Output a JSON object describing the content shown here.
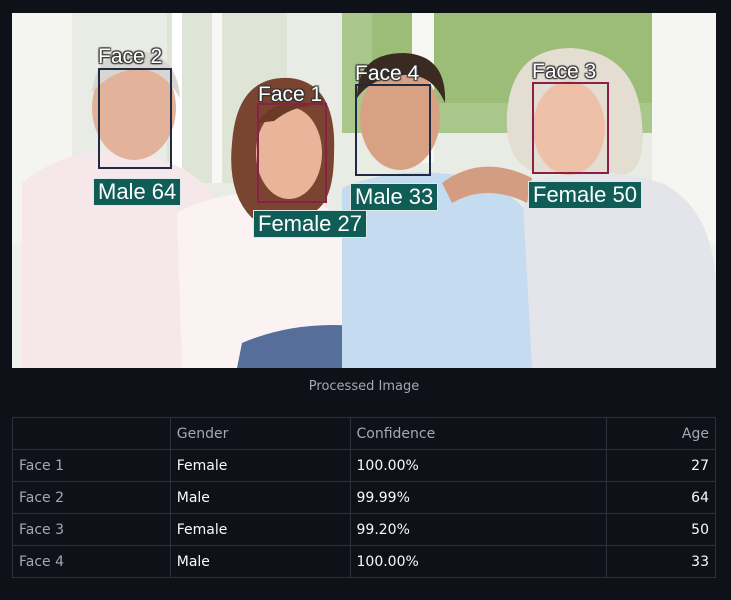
{
  "image": {
    "faces": [
      {
        "title": "Face 2",
        "tag": "Male 64",
        "gender": "male"
      },
      {
        "title": "Face 1",
        "tag": "Female 27",
        "gender": "female"
      },
      {
        "title": "Face 4",
        "tag": "Male 33",
        "gender": "male"
      },
      {
        "title": "Face 3",
        "tag": "Female 50",
        "gender": "female"
      }
    ],
    "caption": "Processed Image"
  },
  "table": {
    "columns": [
      "",
      "Gender",
      "Confidence",
      "Age"
    ],
    "rows": [
      {
        "index": "Face 1",
        "gender": "Female",
        "confidence": "100.00%",
        "age": "27"
      },
      {
        "index": "Face 2",
        "gender": "Male",
        "confidence": "99.99%",
        "age": "64"
      },
      {
        "index": "Face 3",
        "gender": "Female",
        "confidence": "99.20%",
        "age": "50"
      },
      {
        "index": "Face 4",
        "gender": "Male",
        "confidence": "100.00%",
        "age": "33"
      }
    ]
  },
  "colors": {
    "background": "#0e1117",
    "tag_background": "#0f5d56",
    "male_box": "#1f2a44",
    "female_box": "#8a1f4a"
  }
}
